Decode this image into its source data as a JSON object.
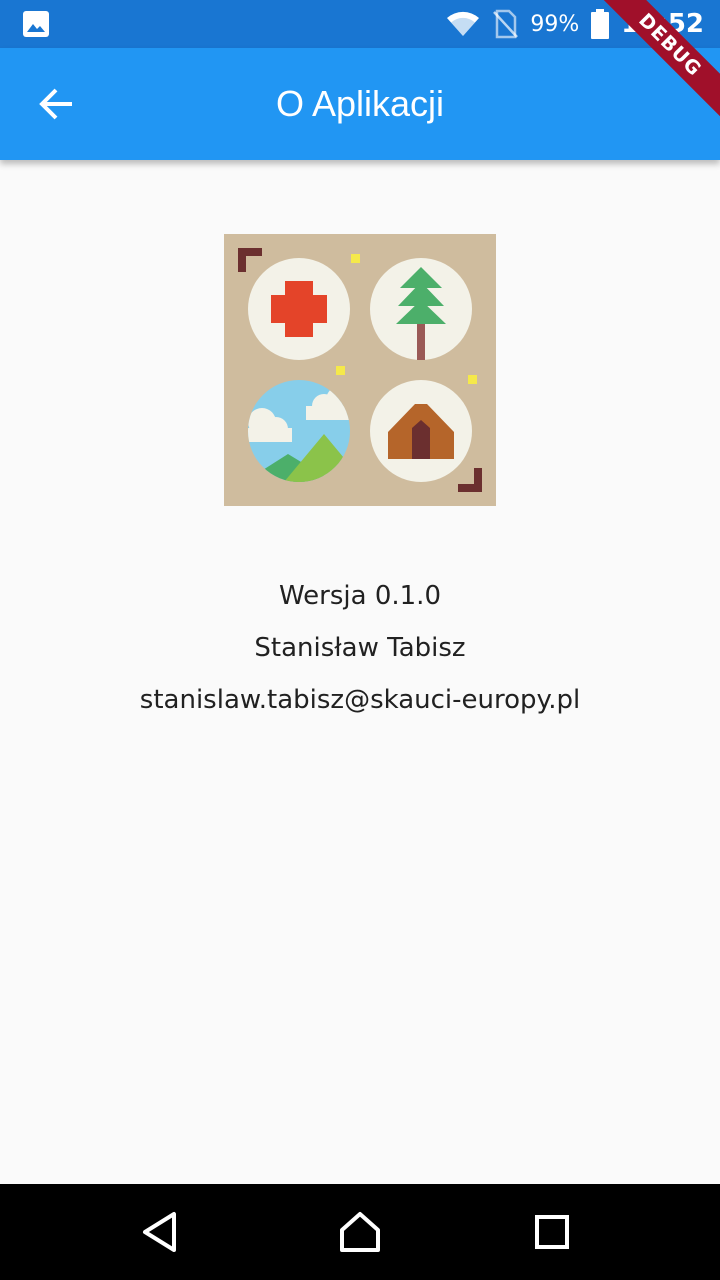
{
  "status_bar": {
    "battery_percent": "99%",
    "time": "14:52",
    "icons": [
      "image-icon",
      "wifi-icon",
      "no-sim-icon",
      "battery-icon"
    ]
  },
  "app_bar": {
    "title": "O Aplikacji",
    "back_icon": "arrow-back-icon",
    "debug_label": "DEBUG"
  },
  "logo": {
    "name": "scout-badges-logo",
    "quadrants": [
      "first-aid-cross",
      "pine-tree",
      "landscape-hills",
      "tent"
    ]
  },
  "info": {
    "version": "Wersja 0.1.0",
    "author": "Stanisław Tabisz",
    "email": "stanislaw.tabisz@skauci-europy.pl"
  },
  "nav_bar": {
    "buttons": [
      "back-triangle-icon",
      "home-icon",
      "recents-square-icon"
    ]
  },
  "colors": {
    "status_bar": "#1976d2",
    "app_bar": "#2196f3",
    "background": "#fafafa",
    "logo_bg": "#cfbc9e",
    "circle": "#f3f2e8"
  }
}
